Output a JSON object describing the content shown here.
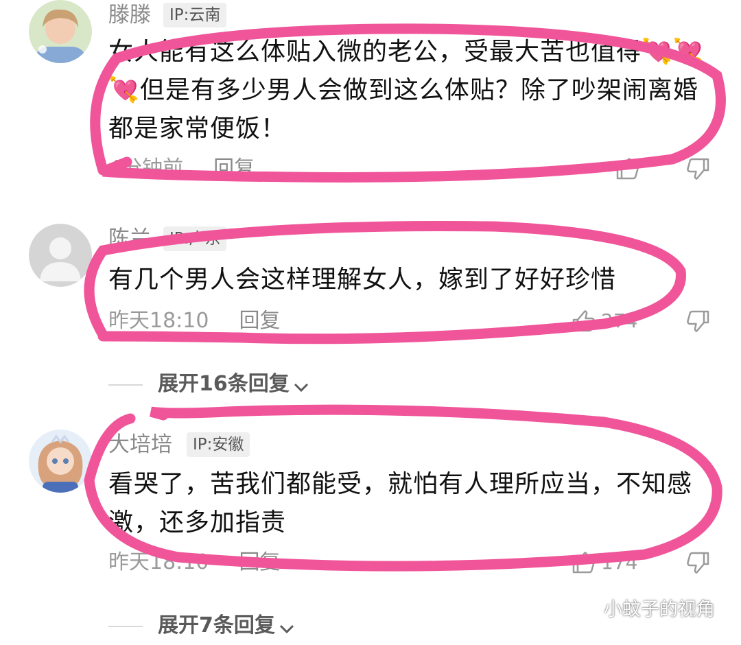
{
  "comments": [
    {
      "username": "滕滕",
      "ip": "IP:云南",
      "text": "女人能有这么体贴入微的老公，受最大苦也值得💘💘💘但是有多少男人会做到这么体贴？除了吵架闹离婚都是家常便饭！",
      "time": "4分钟前",
      "reply_label": "回复",
      "like_count": ""
    },
    {
      "username": "陈兰",
      "ip": "IP:广东",
      "text": "有几个男人会这样理解女人，嫁到了好好珍惜",
      "time": "昨天18:10",
      "reply_label": "回复",
      "like_count": "274",
      "expand_label": "展开16条回复"
    },
    {
      "username": "大培培",
      "ip": "IP:安徽",
      "text": "看哭了，苦我们都能受，就怕有人理所应当，不知感激，还多加指责",
      "time": "昨天18:10",
      "reply_label": "回复",
      "like_count": "174",
      "expand_label": "展开7条回复"
    }
  ],
  "watermark": "小蚊子的视角",
  "colors": {
    "highlight_circle": "#f0559a",
    "meta_text": "#9a9a9a",
    "ip_badge_bg": "#efefef"
  },
  "icons": [
    "thumb-up-icon",
    "thumb-down-icon",
    "chevron-down-icon",
    "wechat-icon"
  ]
}
